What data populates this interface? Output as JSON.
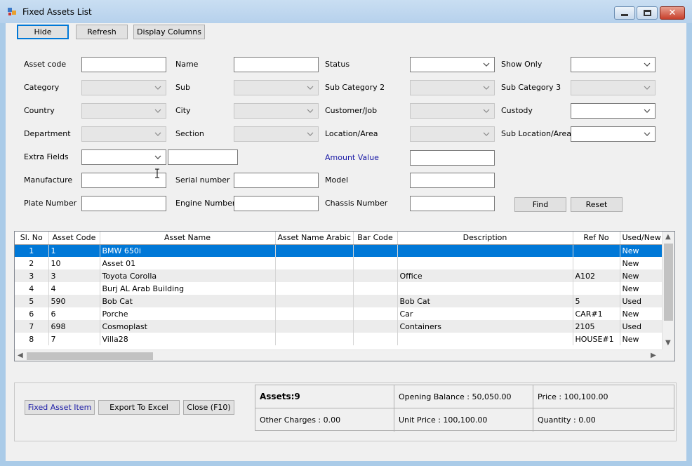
{
  "window": {
    "title": "Fixed Assets List"
  },
  "toolbar": {
    "hide": "Hide",
    "refresh": "Refresh",
    "display_columns": "Display Columns"
  },
  "filters": {
    "asset_code": "Asset code",
    "name": "Name",
    "status": "Status",
    "show_only": "Show Only",
    "category": "Category",
    "sub": "Sub",
    "sub_category_2": "Sub Category 2",
    "sub_category_3": "Sub Category 3",
    "country": "Country",
    "city": "City",
    "customer_job": "Customer/Job",
    "custody": "Custody",
    "department": "Department",
    "section": "Section",
    "location_area": "Location/Area",
    "sub_location_area": "Sub Location/Area",
    "extra_fields": "Extra Fields",
    "amount_value": "Amount Value",
    "manufacture": "Manufacture",
    "serial_number": "Serial number",
    "model": "Model",
    "plate_number": "Plate Number",
    "engine_number": "Engine Number",
    "chassis_number": "Chassis Number",
    "find": "Find",
    "reset": "Reset"
  },
  "grid": {
    "columns": [
      "Sl. No",
      "Asset Code",
      "Asset Name",
      "Asset Name Arabic",
      "Bar Code",
      "Description",
      "Ref No",
      "Used/New"
    ],
    "rows": [
      {
        "sl": "1",
        "code": "1",
        "name": "BMW 650i",
        "arabic": "",
        "barcode": "",
        "desc": "",
        "ref": "",
        "used": "New"
      },
      {
        "sl": "2",
        "code": "10",
        "name": "Asset 01",
        "arabic": "",
        "barcode": "",
        "desc": "",
        "ref": "",
        "used": "New"
      },
      {
        "sl": "3",
        "code": "3",
        "name": "Toyota Corolla",
        "arabic": "",
        "barcode": "",
        "desc": "Office",
        "ref": "A102",
        "used": "New"
      },
      {
        "sl": "4",
        "code": "4",
        "name": "Burj AL Arab Building",
        "arabic": "",
        "barcode": "",
        "desc": "",
        "ref": "",
        "used": "New"
      },
      {
        "sl": "5",
        "code": "590",
        "name": "Bob Cat",
        "arabic": "",
        "barcode": "",
        "desc": "Bob Cat",
        "ref": "5",
        "used": "Used"
      },
      {
        "sl": "6",
        "code": "6",
        "name": "Porche",
        "arabic": "",
        "barcode": "",
        "desc": "Car",
        "ref": "CAR#1",
        "used": "New"
      },
      {
        "sl": "7",
        "code": "698",
        "name": "Cosmoplast",
        "arabic": "",
        "barcode": "",
        "desc": "Containers",
        "ref": "2105",
        "used": "Used"
      },
      {
        "sl": "8",
        "code": "7",
        "name": "Villa28",
        "arabic": "",
        "barcode": "",
        "desc": "",
        "ref": "HOUSE#1",
        "used": "New"
      }
    ]
  },
  "actions": {
    "fixed_asset_item": "Fixed Asset Item",
    "export_excel": "Export To Excel",
    "close": "Close (F10)"
  },
  "summary": {
    "assets": "Assets:9",
    "opening_balance": "Opening Balance  : 50,050.00",
    "price": "Price  : 100,100.00",
    "other_charges": "Other Charges  : 0.00",
    "unit_price": "Unit Price  : 100,100.00",
    "quantity": "Quantity  : 0.00"
  }
}
